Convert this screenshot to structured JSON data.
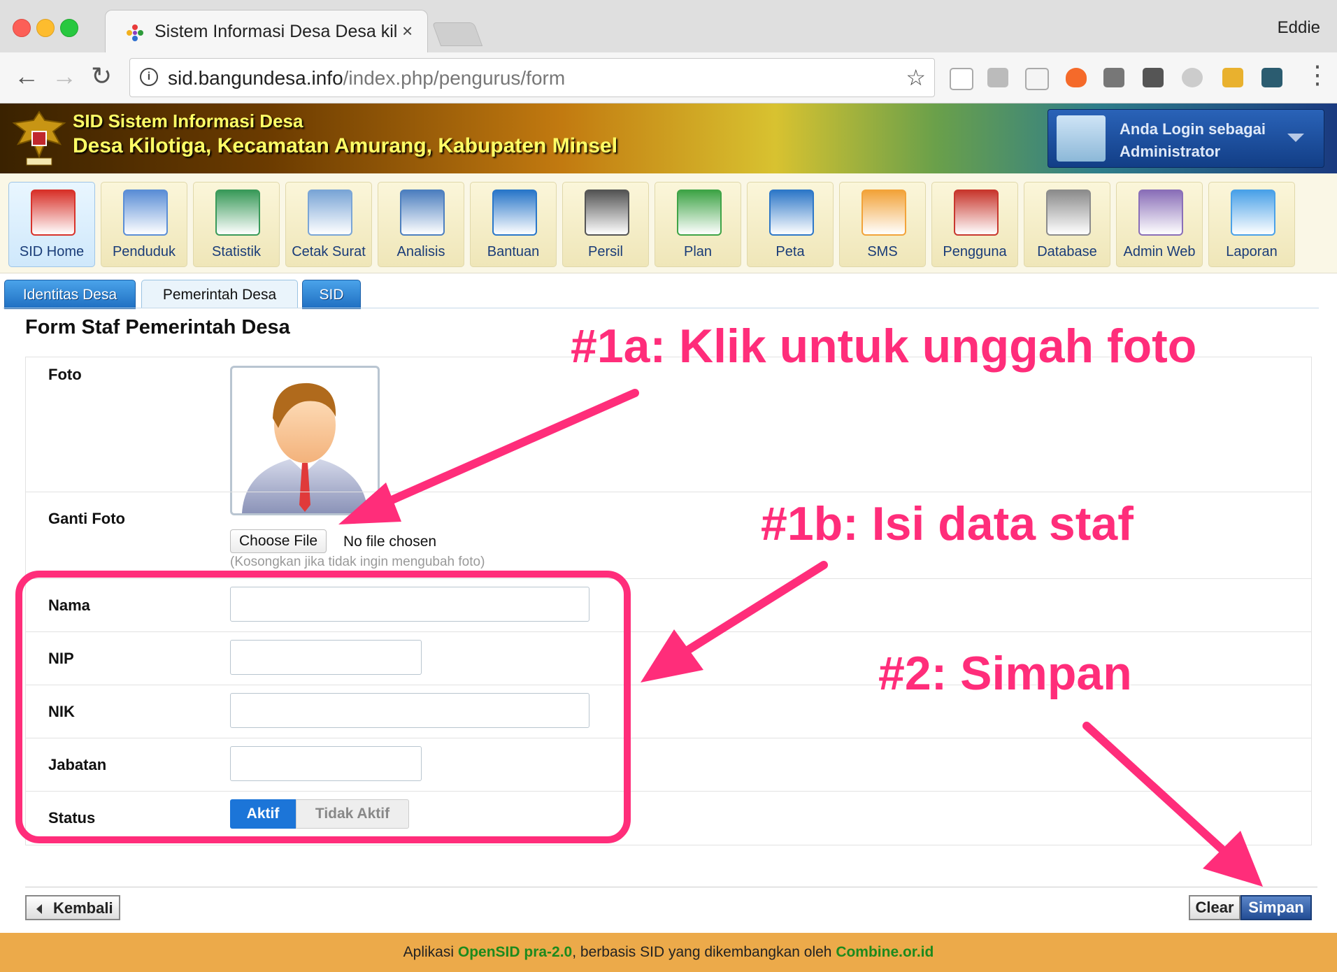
{
  "browser": {
    "tab_title": "Sistem Informasi Desa Desa kil",
    "close_glyph": "×",
    "profile_name": "Eddie",
    "url_host": "sid.bangundesa.info",
    "url_path": "/index.php/pengurus/form",
    "back_glyph": "←",
    "forward_glyph": "→",
    "reload_glyph": "↻",
    "info_glyph": "i",
    "star_glyph": "☆",
    "menu_glyph": "⋮",
    "extensions": [
      "mail-icon",
      "trello-icon",
      "card-icon",
      "flame-icon",
      "github-icon",
      "bulb-icon",
      "gear-icon",
      "calendar-icon",
      "app-icon"
    ]
  },
  "header": {
    "line1": "SID Sistem Informasi Desa",
    "line2": "Desa Kilotiga, Kecamatan Amurang, Kabupaten Minsel",
    "login_line1": "Anda Login sebagai",
    "login_line2": "Administrator"
  },
  "menu": [
    {
      "label": "SID Home",
      "icon": "home-icon",
      "color": "#d8322a",
      "active": true
    },
    {
      "label": "Penduduk",
      "icon": "person-icon",
      "color": "#5b8ed6"
    },
    {
      "label": "Statistik",
      "icon": "chart-icon",
      "color": "#3a9a5a"
    },
    {
      "label": "Cetak Surat",
      "icon": "document-icon",
      "color": "#7aa5d6"
    },
    {
      "label": "Analisis",
      "icon": "binders-icon",
      "color": "#4d7fbf"
    },
    {
      "label": "Bantuan",
      "icon": "window-icon",
      "color": "#2a77c9"
    },
    {
      "label": "Persil",
      "icon": "map-pin-icon",
      "color": "#555555"
    },
    {
      "label": "Plan",
      "icon": "plan-icon",
      "color": "#3fa447"
    },
    {
      "label": "Peta",
      "icon": "globe-icon",
      "color": "#2f78c8"
    },
    {
      "label": "SMS",
      "icon": "sms-icon",
      "color": "#f2a33a"
    },
    {
      "label": "Pengguna",
      "icon": "users-icon",
      "color": "#c8382e"
    },
    {
      "label": "Database",
      "icon": "database-icon",
      "color": "#8c8c8c"
    },
    {
      "label": "Admin Web",
      "icon": "admin-icon",
      "color": "#8a6fb8"
    },
    {
      "label": "Laporan",
      "icon": "mail-arrow-icon",
      "color": "#4aa1e8"
    }
  ],
  "subtabs": [
    "Identitas Desa",
    "Pemerintah Desa",
    "SID"
  ],
  "form": {
    "title": "Form Staf Pemerintah Desa",
    "foto_label": "Foto",
    "ganti_foto_label": "Ganti Foto",
    "choose_file": "Choose File",
    "no_file": "No file chosen",
    "hint": "(Kosongkan jika tidak ingin mengubah foto)",
    "nama_label": "Nama",
    "nama_value": "",
    "nip_label": "NIP",
    "nip_value": "",
    "nik_label": "NIK",
    "nik_value": "",
    "jabatan_label": "Jabatan",
    "jabatan_value": "",
    "status_label": "Status",
    "status_on": "Aktif",
    "status_off": "Tidak Aktif"
  },
  "buttons": {
    "back": "Kembali",
    "clear": "Clear",
    "save": "Simpan"
  },
  "footer": {
    "prefix": "Aplikasi ",
    "app": "OpenSID pra-2.0",
    "middle": ", berbasis SID yang dikembangkan oleh ",
    "org": "Combine.or.id"
  },
  "annotations": {
    "a1": "#1a: Klik untuk unggah foto",
    "a2": "#1b: Isi data staf",
    "a3": "#2: Simpan",
    "color": "#ff2d7a"
  }
}
